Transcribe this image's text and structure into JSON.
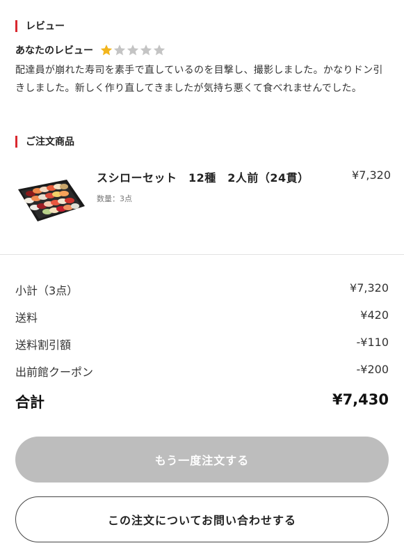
{
  "review": {
    "section_title": "レビュー",
    "your_review_label": "あなたのレビュー",
    "rating": 1,
    "max_rating": 5,
    "text": "配達員が崩れた寿司を素手で直しているのを目撃し、撮影しました。かなりドン引きしました。新しく作り直してきましたが気持ち悪くて食べれませんでした。"
  },
  "order": {
    "section_title": "ご注文商品",
    "item": {
      "name": "スシローセット　12種　2人前（24貫）",
      "price": "¥7,320",
      "quantity": "数量：3点"
    }
  },
  "summary": {
    "rows": [
      {
        "label": "小計（3点）",
        "value": "¥7,320"
      },
      {
        "label": "送料",
        "value": "¥420"
      },
      {
        "label": "送料割引額",
        "value": "-¥110"
      },
      {
        "label": "出前館クーポン",
        "value": "-¥200"
      }
    ],
    "total_label": "合計",
    "total_value": "¥7,430"
  },
  "buttons": {
    "reorder": "もう一度注文する",
    "inquiry": "この注文についてお問い合わせする"
  },
  "colors": {
    "accent": "#d9282f",
    "star_on": "#f2b51d",
    "star_off": "#c4c4c4",
    "disabled_button": "#bdbdbd"
  }
}
